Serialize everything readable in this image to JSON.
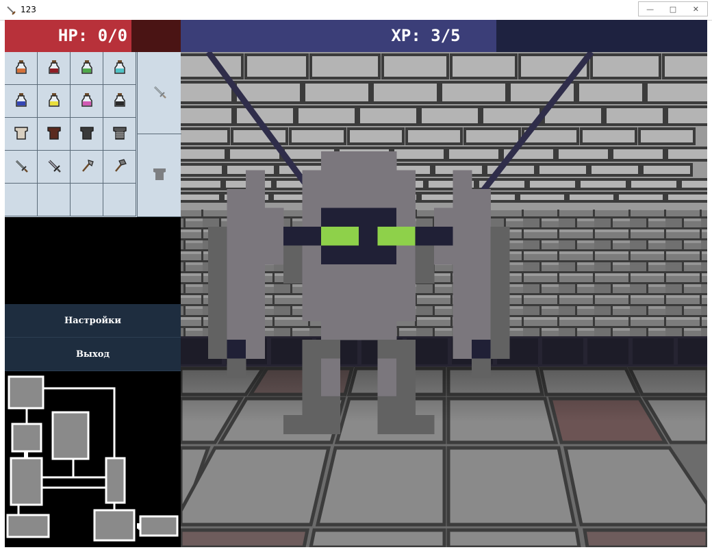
{
  "window": {
    "title": "123",
    "buttons": {
      "minimize": "—",
      "maximize": "□",
      "close": "✕"
    }
  },
  "hud": {
    "hp": {
      "label": "HP: 0/0",
      "current": 0,
      "max": 0,
      "fill_fraction": 0.72,
      "fill_color": "#b8313a",
      "empty_color": "#4a1414"
    },
    "xp": {
      "label": "XP: 3/5",
      "current": 3,
      "max": 5,
      "fill_fraction": 0.6,
      "fill_color": "#3b3e78",
      "empty_color": "#1e2240"
    }
  },
  "inventory": {
    "slots": [
      {
        "item": "potion-orange-icon"
      },
      {
        "item": "potion-red-icon"
      },
      {
        "item": "potion-green-icon"
      },
      {
        "item": "potion-cyan-icon"
      },
      {
        "item": "potion-blue-icon"
      },
      {
        "item": "potion-yellow-icon"
      },
      {
        "item": "potion-pink-icon"
      },
      {
        "item": "potion-black-icon"
      },
      {
        "item": "cloth-armor-icon"
      },
      {
        "item": "leather-armor-icon"
      },
      {
        "item": "dark-armor-icon"
      },
      {
        "item": "chain-armor-icon"
      },
      {
        "item": "sword-icon"
      },
      {
        "item": "broad-sword-icon"
      },
      {
        "item": "axe-icon"
      },
      {
        "item": "hammer-icon"
      },
      {
        "item": ""
      },
      {
        "item": ""
      },
      {
        "item": ""
      },
      {
        "item": ""
      }
    ],
    "equipped": {
      "weapon": "sword-icon",
      "armor": "armor-silhouette-icon"
    }
  },
  "menu": {
    "settings_label": "Настройки",
    "exit_label": "Выход"
  },
  "scene": {
    "enemy": "stone-golem",
    "enemy_eye_color": "#8ed14a"
  },
  "minimap": {
    "background": "#000000",
    "room_color": "#8a8a8a"
  }
}
